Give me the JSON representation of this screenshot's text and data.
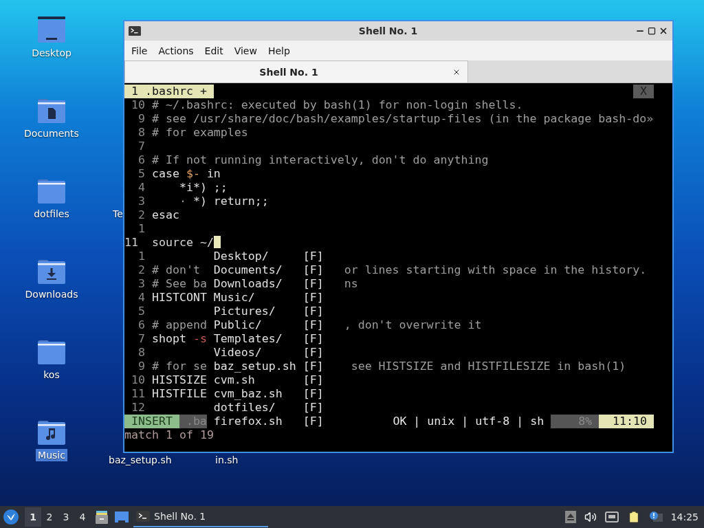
{
  "desktop": {
    "icons": [
      {
        "label": "Desktop",
        "kind": "desktop",
        "selected": false
      },
      {
        "label": "Documents",
        "kind": "documents",
        "selected": false
      },
      {
        "label": "dotfiles",
        "kind": "folder",
        "selected": false
      },
      {
        "label": "Downloads",
        "kind": "downloads",
        "selected": false
      },
      {
        "label": "kos",
        "kind": "folder",
        "selected": false
      },
      {
        "label": "Music",
        "kind": "music",
        "selected": true
      }
    ],
    "covered_labels": [
      {
        "label": "Te"
      },
      {
        "label": "baz_setup.sh"
      },
      {
        "label": "in.sh"
      }
    ]
  },
  "window": {
    "title": "Shell No. 1",
    "menu": [
      "File",
      "Actions",
      "Edit",
      "View",
      "Help"
    ],
    "tabs": [
      {
        "label": "Shell No. 1",
        "selected": true
      }
    ]
  },
  "editor": {
    "buffer_tab": "1 .bashrc +",
    "close_label": "X",
    "lines": [
      {
        "number": "10",
        "segments": [
          {
            "text": "# ~/.bashrc: executed by bash(1) for non-login shells.",
            "kind": "comment"
          }
        ]
      },
      {
        "number": "9",
        "segments": [
          {
            "text": "# see /usr/share/doc/bash/examples/startup-files (in the package bash-do»",
            "kind": "comment"
          }
        ]
      },
      {
        "number": "8",
        "segments": [
          {
            "text": "# for examples",
            "kind": "comment"
          }
        ]
      },
      {
        "number": "7"
      },
      {
        "number": "6",
        "segments": [
          {
            "text": "# If not running interactively, don't do anything",
            "kind": "comment"
          }
        ]
      },
      {
        "number": "5",
        "segments": [
          {
            "text": "case ",
            "kind": "code"
          },
          {
            "text": "$-",
            "kind": "variable"
          },
          {
            "text": " in",
            "kind": "code"
          }
        ]
      },
      {
        "number": "4",
        "segments": [
          {
            "text": "    *i*) ;;",
            "kind": "code"
          }
        ]
      },
      {
        "number": "3",
        "segments": [
          {
            "text": "    ·",
            "kind": "comment"
          },
          {
            "text": " *) return;;",
            "kind": "code"
          }
        ]
      },
      {
        "number": "2",
        "segments": [
          {
            "text": "esac",
            "kind": "code"
          }
        ]
      },
      {
        "number": "1"
      }
    ],
    "cursor_line": {
      "number": "11",
      "text": "source ~/"
    },
    "lower_lines": [
      {
        "number": "1"
      },
      {
        "number": "2",
        "left": [
          {
            "text": "# don't",
            "kind": "comment"
          }
        ],
        "right": "or lines starting with space in the history."
      },
      {
        "number": "3",
        "left": [
          {
            "text": "# See ba",
            "kind": "comment"
          }
        ],
        "right": "ns"
      },
      {
        "number": "4",
        "left": [
          {
            "text": "HISTCONT",
            "kind": "code"
          }
        ]
      },
      {
        "number": "5"
      },
      {
        "number": "6",
        "left": [
          {
            "text": "# append",
            "kind": "comment"
          }
        ],
        "right": ", don't overwrite it"
      },
      {
        "number": "7",
        "left": [
          {
            "text": "shopt ",
            "kind": "code"
          },
          {
            "text": "-s",
            "kind": "flag"
          }
        ]
      },
      {
        "number": "8"
      },
      {
        "number": "9",
        "left": [
          {
            "text": "# for se",
            "kind": "comment"
          }
        ],
        "right": " see HISTSIZE and HISTFILESIZE in bash(1)"
      },
      {
        "number": "10",
        "left": [
          {
            "text": "HISTSIZE",
            "kind": "code"
          }
        ]
      },
      {
        "number": "11",
        "left": [
          {
            "text": "HISTFILE",
            "kind": "code"
          }
        ]
      },
      {
        "number": "12"
      }
    ],
    "completion": [
      {
        "name": "Desktop/",
        "flag": "[F]"
      },
      {
        "name": "Documents/",
        "flag": "[F]"
      },
      {
        "name": "Downloads/",
        "flag": "[F]"
      },
      {
        "name": "Music/",
        "flag": "[F]"
      },
      {
        "name": "Pictures/",
        "flag": "[F]"
      },
      {
        "name": "Public/",
        "flag": "[F]"
      },
      {
        "name": "Templates/",
        "flag": "[F]"
      },
      {
        "name": "Videos/",
        "flag": "[F]"
      },
      {
        "name": "baz_setup.sh",
        "flag": "[F]"
      },
      {
        "name": "cvm.sh",
        "flag": "[F]"
      },
      {
        "name": "cvm_baz.sh",
        "flag": "[F]"
      },
      {
        "name": "dotfiles/",
        "flag": "[F]"
      },
      {
        "name": "firefox.sh",
        "flag": "[F]"
      }
    ],
    "status": {
      "mode": "INSERT",
      "file": ".ba",
      "info": "OK | unix | utf-8 | sh",
      "percent": "8%",
      "position": "11:10"
    },
    "message": "match 1 of 19"
  },
  "taskbar": {
    "workspaces": [
      {
        "label": "1",
        "selected": true
      },
      {
        "label": "2",
        "selected": false
      },
      {
        "label": "3",
        "selected": false
      },
      {
        "label": "4",
        "selected": false
      }
    ],
    "tasks": [
      {
        "label": "Shell No. 1",
        "selected": true
      }
    ],
    "clock": "14:25"
  }
}
